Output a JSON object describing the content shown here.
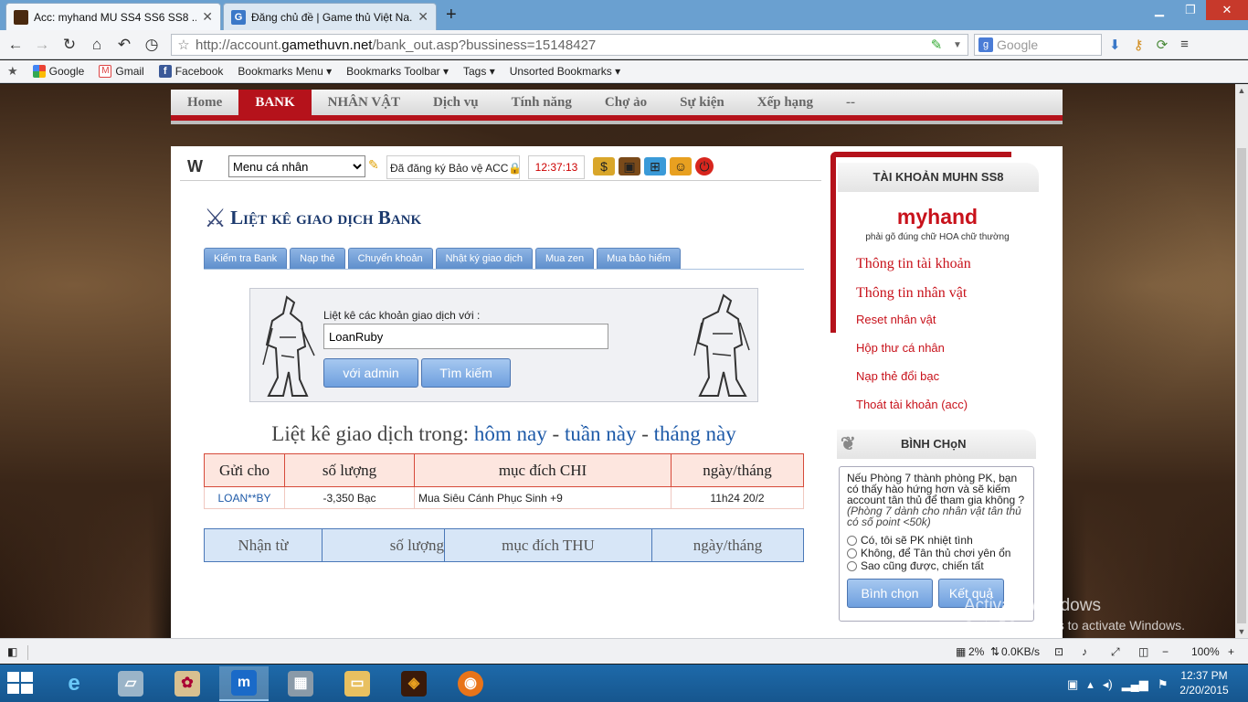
{
  "browser": {
    "tabs": [
      {
        "title": "Acc: myhand MU SS4 SS6 SS8 ...",
        "active": true
      },
      {
        "title": "Đăng chủ đề | Game thủ Việt Na...",
        "active": false
      }
    ],
    "url_prefix": "http://account.",
    "url_domain": "gamethuvn.net",
    "url_path": "/bank_out.asp?bussiness=15148427",
    "search_placeholder": "Google",
    "bookmarks": [
      "Google",
      "Gmail",
      "Facebook",
      "Bookmarks Menu",
      "Bookmarks Toolbar",
      "Tags",
      "Unsorted Bookmarks"
    ]
  },
  "site_nav": [
    "Home",
    "BANK",
    "NHÂN VẬT",
    "Dịch vụ",
    "Tính năng",
    "Chợ ảo",
    "Sự kiện",
    "Xếp hạng",
    "--"
  ],
  "toolbar": {
    "menu_select": "Menu cá nhân",
    "registered": "Đã đăng ký Bảo vệ ACC",
    "time": "12:37:13"
  },
  "page": {
    "title": "Liệt kê giao dịch Bank",
    "subtabs": [
      "Kiểm tra Bank",
      "Nạp thẻ",
      "Chuyển khoản",
      "Nhật ký giao dịch",
      "Mua zen",
      "Mua bảo hiểm"
    ],
    "search_label": "Liệt kê các khoản giao dịch với :",
    "search_value": "LoanRuby",
    "btn_admin": "với admin",
    "btn_search": "Tìm kiếm",
    "period_prefix": "Liệt kê giao dịch trong:",
    "period_today": "hôm nay",
    "period_week": "tuần này",
    "period_month": "tháng này",
    "sep": "-"
  },
  "chi_table": {
    "headers": [
      "Gửi cho",
      "số lượng",
      "mục đích CHI",
      "ngày/tháng"
    ],
    "rows": [
      {
        "to": "LOAN**BY",
        "amount": "-3,350  Bạc",
        "purpose": "Mua Siêu Cánh Phục Sinh +9",
        "date": "11h24 20/2"
      }
    ]
  },
  "thu_table": {
    "headers": [
      "Nhận từ",
      "số lượng",
      "mục đích THU",
      "ngày/tháng"
    ]
  },
  "account": {
    "header": "TÀI KHOẢN MUHN SS8",
    "username": "myhand",
    "note": "phải gõ đúng chữ HOA chữ thường",
    "links": [
      "Thông tin tài khoản",
      "Thông tin nhân vật",
      "Reset nhân vật",
      "Hộp thư cá nhân",
      "Nạp thẻ đổi bạc",
      "Thoát tài khoản (acc)"
    ]
  },
  "vote": {
    "header": "BÌNH CHọN",
    "question": "Nếu Phòng 7 thành phòng PK, bạn có thấy hào hứng hơn và sẽ kiếm account tân thủ để tham gia không ?",
    "question_note": "(Phòng 7 dành cho nhân vật tân thủ có số point <50k)",
    "options": [
      "Có, tôi sẽ PK nhiệt tình",
      "Không, để Tân thủ chơi yên ổn",
      "Sao cũng được, chiến tất"
    ],
    "btn_vote": "Bình chọn",
    "btn_result": "Kết quả"
  },
  "watermark": {
    "line1": "Activate Windows",
    "line2": "Go to PC settings to activate Windows."
  },
  "status": {
    "cpu": "2%",
    "net": "0.0KB/s",
    "zoom": "100%"
  },
  "clock": {
    "time": "12:37 PM",
    "date": "2/20/2015"
  }
}
